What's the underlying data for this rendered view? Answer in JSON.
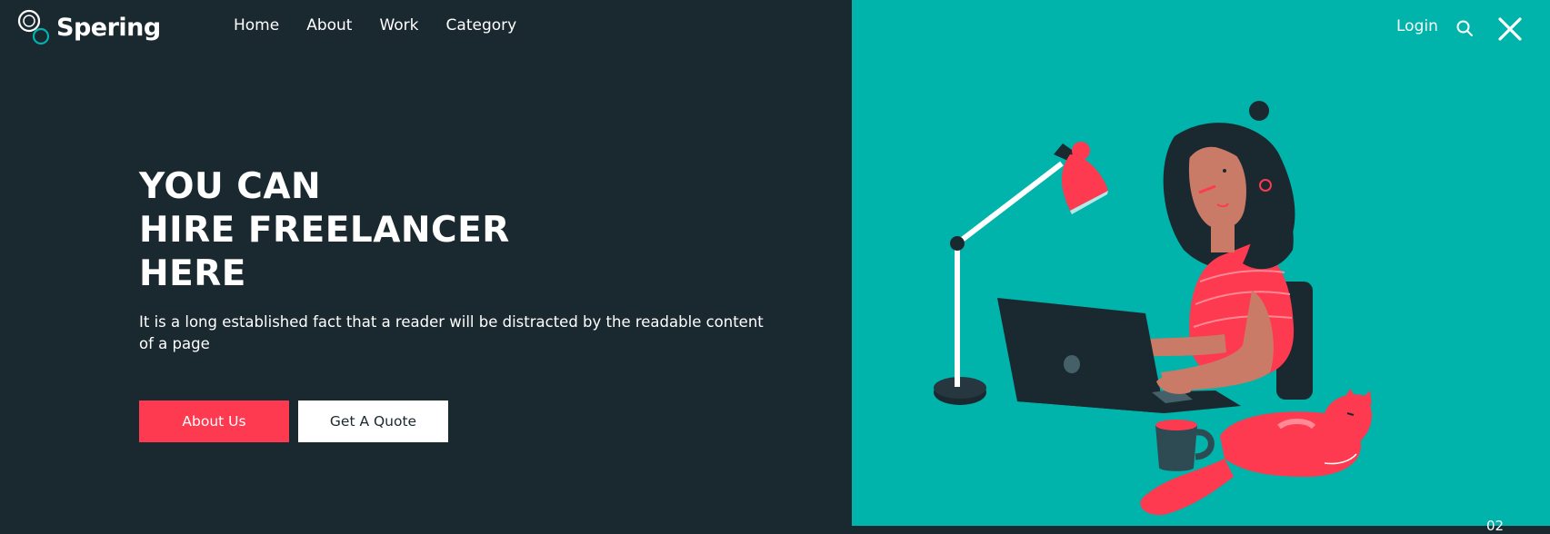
{
  "brand": {
    "name": "Spering",
    "accent_color": "#00b3ab",
    "dark_color": "#1a2830",
    "primary_color": "#fd3a4f"
  },
  "nav": {
    "items": [
      {
        "label": "Home"
      },
      {
        "label": "About"
      },
      {
        "label": "Work"
      },
      {
        "label": "Category"
      }
    ]
  },
  "header_right": {
    "login_label": "Login",
    "search_icon": "search-icon",
    "close_icon": "close-icon"
  },
  "hero": {
    "title_lines": [
      "YOU CAN",
      "HIRE FREELANCER",
      "HERE"
    ],
    "text": "It is a long established fact that a reader will be distracted by the readable content of a page",
    "primary_button": "About Us",
    "secondary_button": "Get A Quote"
  },
  "slide": {
    "number": "02"
  }
}
